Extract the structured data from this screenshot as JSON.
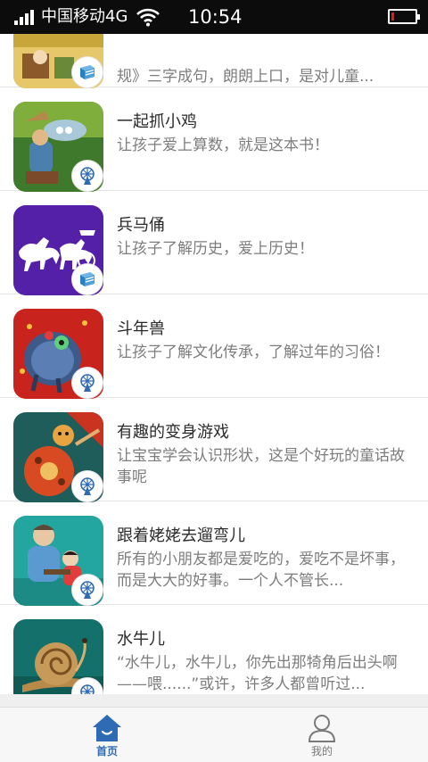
{
  "status_bar": {
    "carrier": "中国移动4G",
    "time": "10:54",
    "battery_level": 0.12,
    "battery_color": "#e8151d"
  },
  "books": [
    {
      "title": "",
      "description": "规》三字成句，朗朗上口，是对儿童...",
      "badge_icon": "book-icon"
    },
    {
      "title": "一起抓小鸡",
      "description": "让孩子爱上算数，就是这本书！",
      "badge_icon": "ferris-wheel-icon"
    },
    {
      "title": "兵马俑",
      "description": "让孩子了解历史，爱上历史！",
      "badge_icon": "book-icon"
    },
    {
      "title": "斗年兽",
      "description": "让孩子了解文化传承，了解过年的习俗！",
      "badge_icon": "ferris-wheel-icon"
    },
    {
      "title": "有趣的变身游戏",
      "description": "让宝宝学会认识形状，这是个好玩的童话故事呢",
      "badge_icon": "ferris-wheel-icon"
    },
    {
      "title": "跟着姥姥去遛弯儿",
      "description": "所有的小朋友都是爱吃的，爱吃不是坏事，而是大大的好事。一个人不管长...",
      "badge_icon": "ferris-wheel-icon"
    },
    {
      "title": "水牛儿",
      "description": "“水牛儿，水牛儿，你先出那犄角后出头啊——喂......”或许，许多人都曾听过...",
      "badge_icon": "ferris-wheel-icon"
    }
  ],
  "tabbar": {
    "home_label": "首页",
    "mine_label": "我的",
    "active_color": "#2f6bb5",
    "inactive_color": "#7a7a7a"
  }
}
